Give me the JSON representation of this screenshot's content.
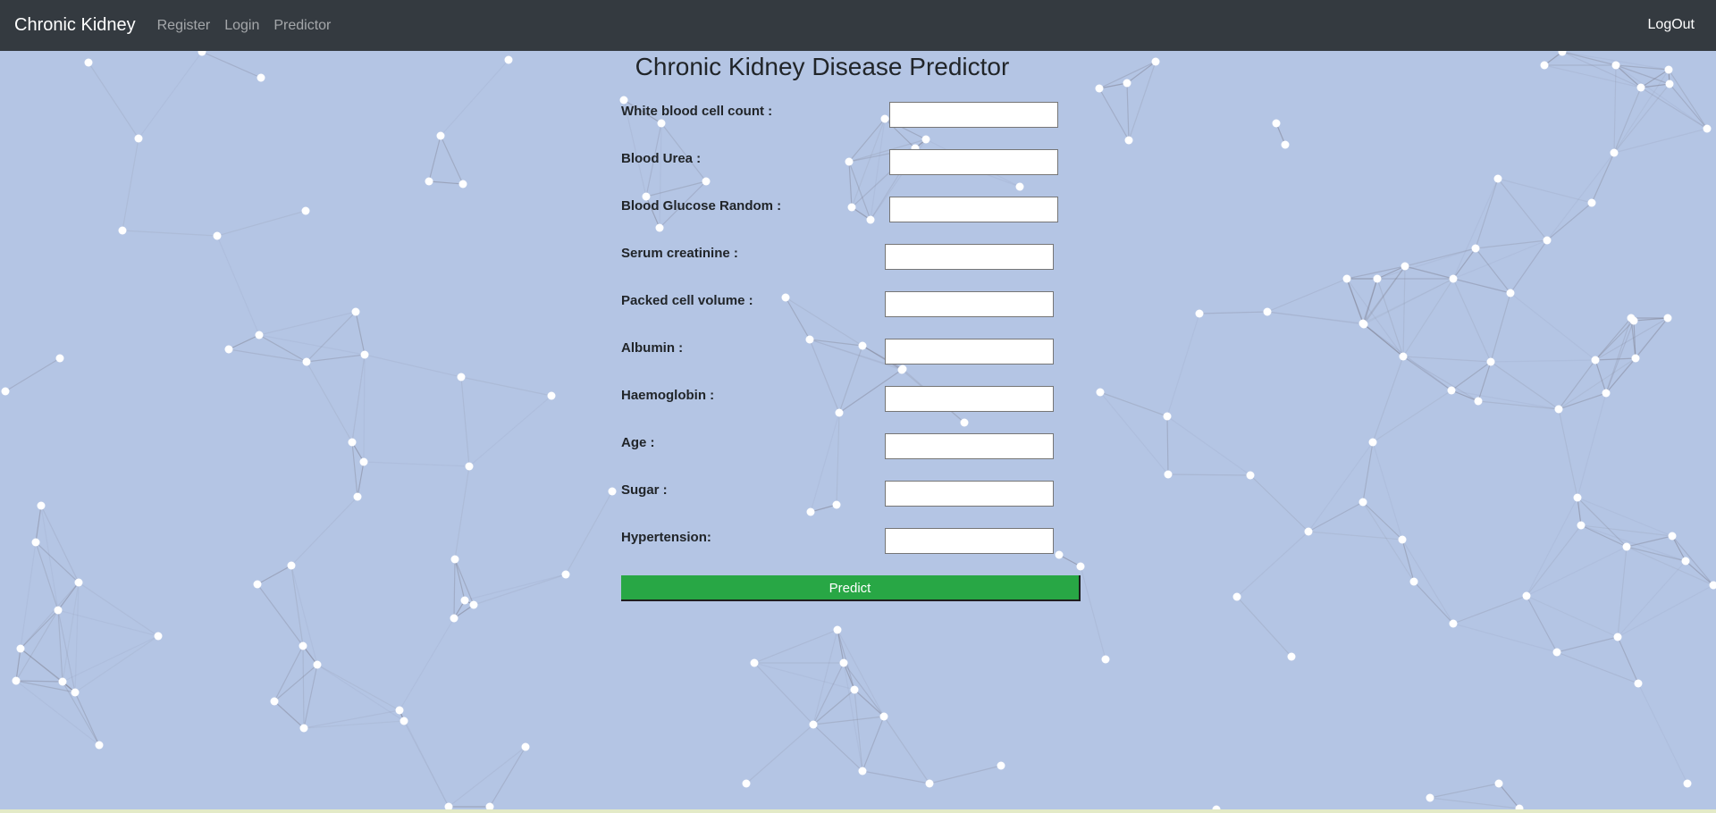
{
  "navbar": {
    "brand": "Chronic Kidney",
    "links": [
      "Register",
      "Login",
      "Predictor"
    ],
    "logout": "LogOut"
  },
  "page": {
    "title": "Chronic Kidney Disease Predictor"
  },
  "form": {
    "fields": [
      {
        "label": "White blood cell count :",
        "value": ""
      },
      {
        "label": "Blood Urea :",
        "value": ""
      },
      {
        "label": "Blood Glucose Random :",
        "value": ""
      },
      {
        "label": "Serum creatinine :",
        "value": ""
      },
      {
        "label": "Packed cell volume :",
        "value": ""
      },
      {
        "label": "Albumin :",
        "value": ""
      },
      {
        "label": "Haemoglobin :",
        "value": ""
      },
      {
        "label": "Age :",
        "value": ""
      },
      {
        "label": "Sugar :",
        "value": ""
      },
      {
        "label": "Hypertension:",
        "value": ""
      }
    ],
    "submit_label": "Predict"
  },
  "colors": {
    "navbar": "#343a40",
    "background": "#b4c5e4",
    "predict_button": "#28a745"
  }
}
